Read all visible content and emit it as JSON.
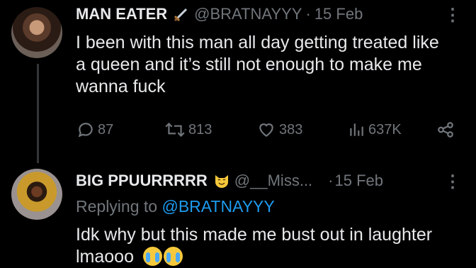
{
  "tweet1": {
    "display_name": "MAN EATER",
    "badge_icon": "dagger-icon",
    "handle": "@BRATNAYYY",
    "separator": "·",
    "date": "15 Feb",
    "text_line1": "I been with this man all day getting treated like",
    "text_line2": "a queen and it’s still not enough to make me",
    "text_line3": "wanna fuck",
    "replies": "87",
    "retweets": "813",
    "likes": "383",
    "views": "637K"
  },
  "tweet2": {
    "display_name": "BIG PPUURRRRR",
    "badge_icon": "cat-emoji-icon",
    "handle": "@__Miss...",
    "separator": "·",
    "date": "15 Feb",
    "replying_prefix": "Replying to",
    "replying_handle": "@BRATNAYYY",
    "text_line1": "Idk why but this made me bust out in laughter",
    "text_line2": "lmaooo"
  },
  "colors": {
    "background": "#000000",
    "text": "#e7e9ea",
    "muted": "#71767b",
    "link": "#1d9bf0"
  }
}
